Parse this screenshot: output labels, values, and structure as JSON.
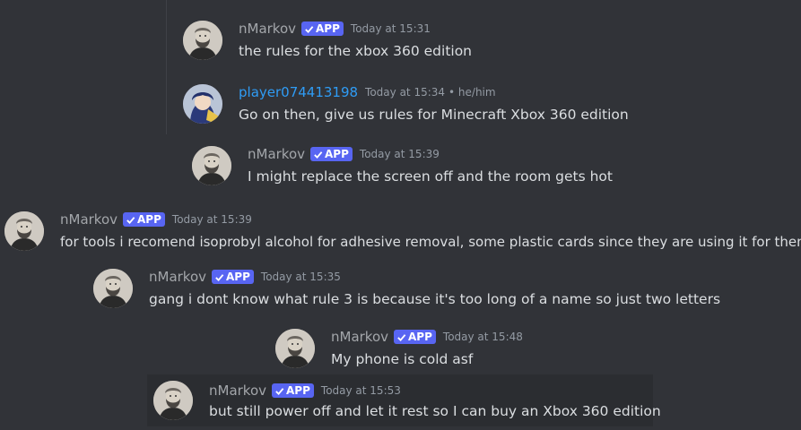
{
  "colors": {
    "background": "#313338",
    "panel": "#2b2d31",
    "username": "#a3a6aa",
    "username_link": "#2f9cf5",
    "app_badge": "#5865f2",
    "message_text": "#dbdee1",
    "timestamp": "#949ba4"
  },
  "icons": {
    "badge_check": "checkmark-icon",
    "avatar_bot": "bearded-man-portrait",
    "avatar_user": "anime-character-portrait"
  },
  "messages": [
    {
      "author": "nMarkov",
      "badge": "APP",
      "timestamp": "Today at 15:31",
      "text": "the rules for the xbox 360 edition"
    },
    {
      "author": "player074413198",
      "timestamp": "Today at 15:34",
      "pronouns": "• he/him",
      "text": "Go on then, give us rules for Minecraft Xbox 360 edition"
    },
    {
      "author": "nMarkov",
      "badge": "APP",
      "timestamp": "Today at 15:39",
      "text": "I might replace the screen off and the room gets hot"
    },
    {
      "author": "nMarkov",
      "badge": "APP",
      "timestamp": "Today at 15:39",
      "text": "for tools i recomend isoprobyl alcohol for adhesive removal, some plastic cards since they are using it for then"
    },
    {
      "author": "nMarkov",
      "badge": "APP",
      "timestamp": "Today at 15:35",
      "text": "gang i dont know what rule 3 is because it's too long of a name so just two letters"
    },
    {
      "author": "nMarkov",
      "badge": "APP",
      "timestamp": "Today at 15:48",
      "text": "My phone is cold asf"
    },
    {
      "author": "nMarkov",
      "badge": "APP",
      "timestamp": "Today at 15:53",
      "text": "but still power off and let it rest so I can buy an Xbox 360 edition"
    }
  ]
}
